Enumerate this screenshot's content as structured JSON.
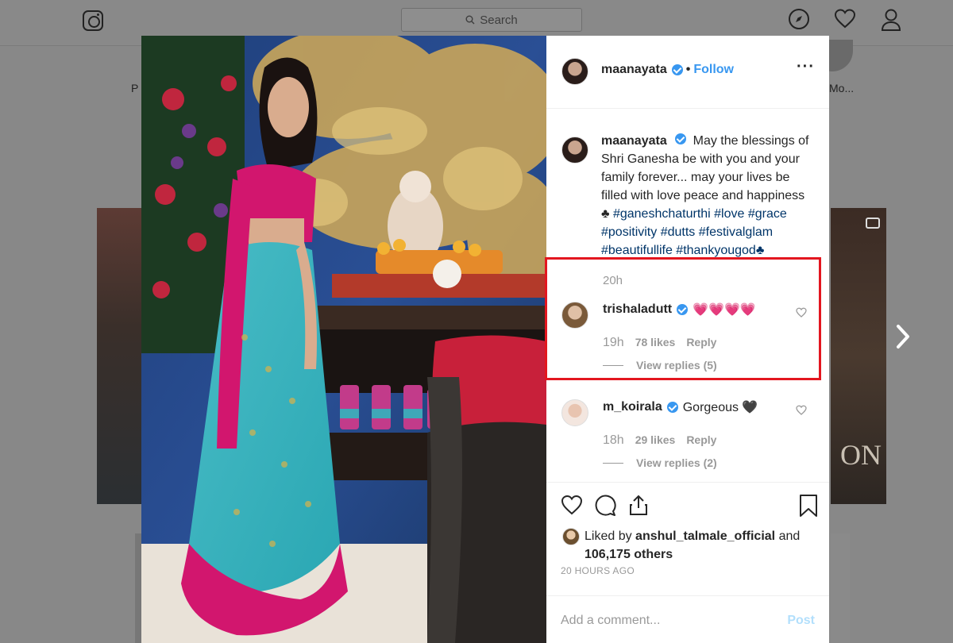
{
  "topbar": {
    "search_placeholder": "Search",
    "icons": [
      "instagram-logo-icon",
      "search-icon",
      "compass-icon",
      "heart-icon",
      "profile-icon"
    ]
  },
  "background": {
    "label_left": "P",
    "label_right": "Mo...",
    "tile_text": "ON"
  },
  "post": {
    "username": "maanayata",
    "dot": "•",
    "follow_label": "Follow",
    "more_label": "···",
    "caption": {
      "username": "maanayata",
      "text": "May the blessings of Shri Ganesha be with you and your family forever... may your lives be filled with love peace and happiness ♣",
      "hashtags": "#ganeshchaturthi #love #grace #positivity #dutts #festivalglam #beautifullife #thankyougod♣",
      "time": "20h"
    },
    "comments": [
      {
        "username": "trishaladutt",
        "text": "💗💗💗💗",
        "time": "19h",
        "likes": "78 likes",
        "reply_label": "Reply",
        "view_replies": "View replies (5)"
      },
      {
        "username": "m_koirala",
        "text": "Gorgeous 🖤",
        "time": "18h",
        "likes": "29 likes",
        "reply_label": "Reply",
        "view_replies": "View replies (2)"
      }
    ],
    "liked_by_prefix": "Liked by",
    "liked_by_user": "anshul_talmale_official",
    "liked_by_and": "and",
    "likes_count": "106,175 others",
    "time_ago": "20 HOURS AGO",
    "comment_placeholder": "Add a comment...",
    "post_label": "Post"
  },
  "colors": {
    "accent": "#3897f0",
    "highlight": "#e3161f",
    "overlay": "#888888"
  }
}
